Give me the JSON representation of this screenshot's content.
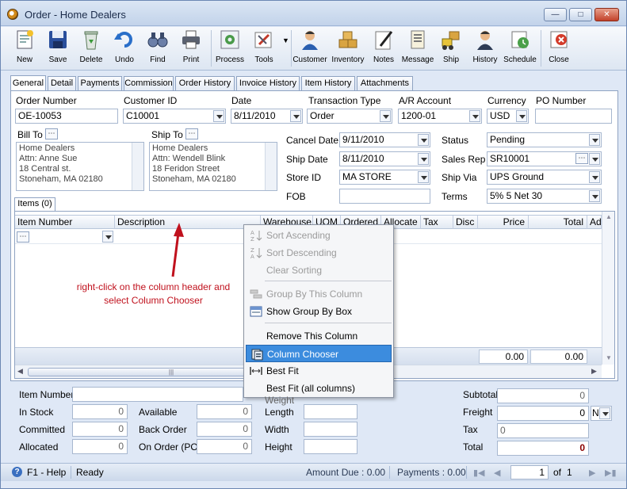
{
  "window": {
    "title": "Order - Home Dealers"
  },
  "toolbar": {
    "new": "New",
    "save": "Save",
    "delete": "Delete",
    "undo": "Undo",
    "find": "Find",
    "print": "Print",
    "process": "Process",
    "tools": "Tools",
    "customer": "Customer",
    "inventory": "Inventory",
    "notes": "Notes",
    "message": "Message",
    "ship": "Ship",
    "history": "History",
    "schedule": "Schedule",
    "close": "Close"
  },
  "tabs": [
    "General",
    "Detail",
    "Payments",
    "Commission",
    "Order History",
    "Invoice History",
    "Item History",
    "Attachments"
  ],
  "header": {
    "order_number_label": "Order Number",
    "order_number": "OE-10053",
    "customer_id_label": "Customer ID",
    "customer_id": "C10001",
    "date_label": "Date",
    "date": "8/11/2010",
    "transaction_type_label": "Transaction Type",
    "transaction_type": "Order",
    "ar_account_label": "A/R Account",
    "ar_account": "1200-01",
    "currency_label": "Currency",
    "currency": "USD",
    "po_number_label": "PO Number",
    "po_number": ""
  },
  "bill_to": {
    "label": "Bill To",
    "lines": [
      "Home Dealers",
      "Attn: Anne Sue",
      "18 Central st.",
      "Stoneham, MA 02180"
    ]
  },
  "ship_to": {
    "label": "Ship To",
    "lines": [
      "Home Dealers",
      "Attn: Wendell Blink",
      "18 Feridon Street",
      "Stoneham, MA 02180"
    ]
  },
  "dates": {
    "cancel_date_label": "Cancel  Date",
    "cancel_date": "9/11/2010",
    "ship_date_label": "Ship Date",
    "ship_date": "8/11/2010",
    "store_id_label": "Store ID",
    "store_id": "MA STORE",
    "fob_label": "FOB",
    "fob": ""
  },
  "right_fields": {
    "status_label": "Status",
    "status": "Pending",
    "sales_rep_label": "Sales Rep",
    "sales_rep": "SR10001",
    "ship_via_label": "Ship Via",
    "ship_via": "UPS Ground",
    "terms_label": "Terms",
    "terms": "5% 5 Net 30"
  },
  "items_tab": "Items (0)",
  "grid": {
    "columns": [
      "Item Number",
      "Description",
      "Warehouse",
      "UOM",
      "Ordered",
      "Allocate",
      "Tax",
      "Disc",
      "Price",
      "Total",
      "Ad"
    ],
    "price_total": "0.00",
    "grand_total": "0.00"
  },
  "annotation": "right-click on the column header and select Column Chooser",
  "context_menu": {
    "sort_ascending": "Sort Ascending",
    "sort_descending": "Sort Descending",
    "clear_sorting": "Clear Sorting",
    "group_by_column": "Group By This Column",
    "show_group_by_box": "Show Group By Box",
    "remove_column": "Remove This Column",
    "column_chooser": "Column Chooser",
    "best_fit": "Best Fit",
    "best_fit_all": "Best Fit (all columns)"
  },
  "bottom": {
    "item_number_label": "Item Number",
    "in_stock_label": "In Stock",
    "in_stock": "0",
    "committed_label": "Committed",
    "committed": "0",
    "allocated_label": "Allocated",
    "allocated": "0",
    "available_label": "Available",
    "available": "0",
    "back_order_label": "Back Order",
    "back_order": "0",
    "on_order_label": "On Order (PO)",
    "on_order": "0",
    "weight_label": "Weight",
    "length_label": "Length",
    "width_label": "Width",
    "height_label": "Height",
    "subtotal_label": "Subtotal",
    "subtotal": "0",
    "freight_label": "Freight",
    "freight": "0",
    "freight_code": "N",
    "tax_label": "Tax",
    "tax": "0",
    "total_label": "Total",
    "total": "0"
  },
  "status": {
    "help": "F1 - Help",
    "ready": "Ready",
    "amount_due": "Amount Due : 0.00",
    "payments": "Payments : 0.00",
    "page": "1",
    "of": "of",
    "pages": "1"
  }
}
